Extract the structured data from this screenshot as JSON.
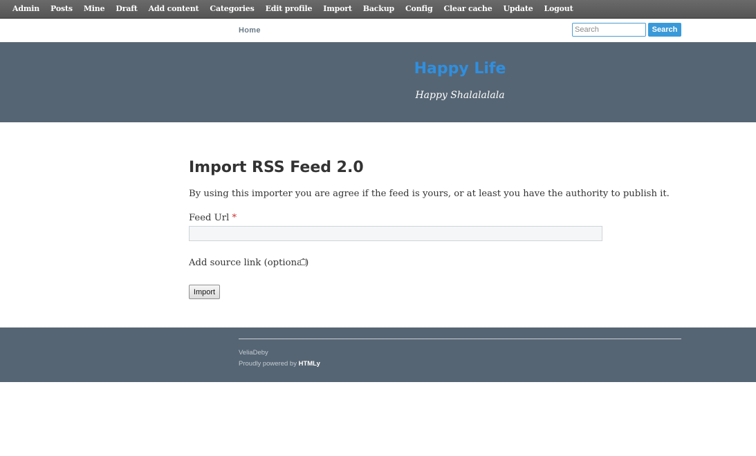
{
  "admin_toolbar": {
    "items": [
      {
        "label": "Admin"
      },
      {
        "label": "Posts"
      },
      {
        "label": "Mine"
      },
      {
        "label": "Draft"
      },
      {
        "label": "Add content"
      },
      {
        "label": "Categories"
      },
      {
        "label": "Edit profile"
      },
      {
        "label": "Import"
      },
      {
        "label": "Backup"
      },
      {
        "label": "Config"
      },
      {
        "label": "Clear cache"
      },
      {
        "label": "Update"
      },
      {
        "label": "Logout"
      }
    ]
  },
  "nav": {
    "home_label": "Home",
    "search_placeholder": "Search",
    "search_value": "",
    "search_button_label": "Search"
  },
  "header": {
    "site_title": "Happy Life",
    "tagline": "Happy Shalalalala",
    "title_color": "#2f8fe0",
    "background_color": "#566573"
  },
  "main": {
    "heading": "Import RSS Feed 2.0",
    "intro": "By using this importer you are agree if the feed is yours, or at least you have the authority to publish it.",
    "feed_url_label": "Feed Url",
    "required_marker": "*",
    "feed_url_value": "",
    "source_link_label": "Add source link (optional)",
    "source_link_checked": false,
    "import_button_label": "Import"
  },
  "footer": {
    "site_name": "VeliaDeby",
    "powered_prefix": "Proudly powered by",
    "powered_link": "HTMLy"
  }
}
